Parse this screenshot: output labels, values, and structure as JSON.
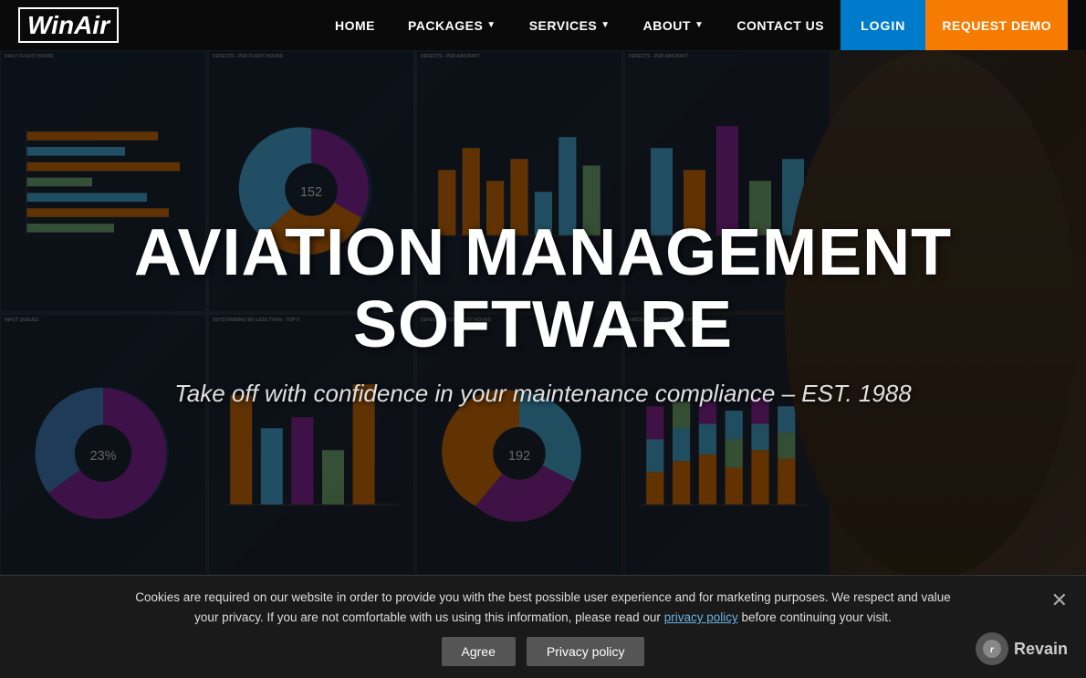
{
  "nav": {
    "logo_text": "WinAir",
    "links": [
      {
        "label": "HOME",
        "has_dropdown": false
      },
      {
        "label": "PACKAGES",
        "has_dropdown": true
      },
      {
        "label": "SERVICES",
        "has_dropdown": true
      },
      {
        "label": "ABOUT",
        "has_dropdown": true
      },
      {
        "label": "CONTACT US",
        "has_dropdown": false
      }
    ],
    "login_label": "LOGIN",
    "demo_label": "REQUEST DEMO"
  },
  "hero": {
    "title": "AVIATION MANAGEMENT SOFTWARE",
    "subtitle": "Take off with confidence in your maintenance compliance – EST. 1988"
  },
  "cookie": {
    "message": "Cookies are required on our website in order to provide you with the best possible user experience and for marketing purposes. We respect and value your privacy. If you are not comfortable with us using this information, please read our",
    "link_text": "privacy policy",
    "message2": "before continuing your visit.",
    "agree_label": "Agree",
    "privacy_label": "Privacy policy"
  },
  "revain": {
    "label": "Revain"
  }
}
